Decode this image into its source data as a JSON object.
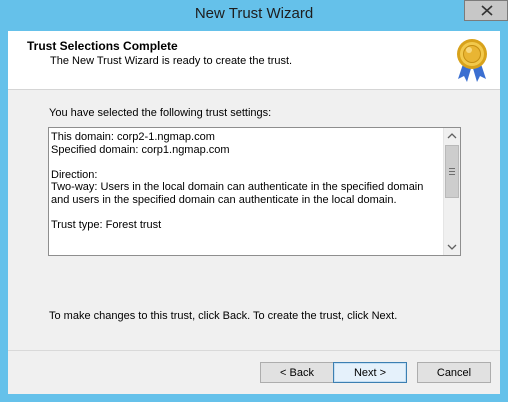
{
  "window": {
    "title": "New Trust Wizard"
  },
  "header": {
    "title": "Trust Selections Complete",
    "subtitle": "The New Trust Wizard is ready to create the trust."
  },
  "main": {
    "intro": "You have selected the following trust settings:",
    "settings": {
      "line1": "This domain: corp2-1.ngmap.com",
      "line2": "Specified domain: corp1.ngmap.com",
      "line3": "Direction:",
      "line4": "Two-way: Users in the local domain can authenticate in the specified domain and users in the specified domain can authenticate in the local domain.",
      "line5": "Trust type: Forest trust"
    },
    "footer_text": "To make changes to this trust, click Back. To create the trust, click Next."
  },
  "buttons": {
    "back": "< Back",
    "next": "Next >",
    "cancel": "Cancel"
  },
  "icons": {
    "close": "close-icon",
    "seal": "award-seal-icon",
    "scroll_up": "chevron-up-icon",
    "scroll_down": "chevron-down-icon"
  },
  "colors": {
    "window_frame": "#65c1ea",
    "dialog_bg": "#f0f0f0",
    "default_button_border": "#3c7fb1"
  }
}
